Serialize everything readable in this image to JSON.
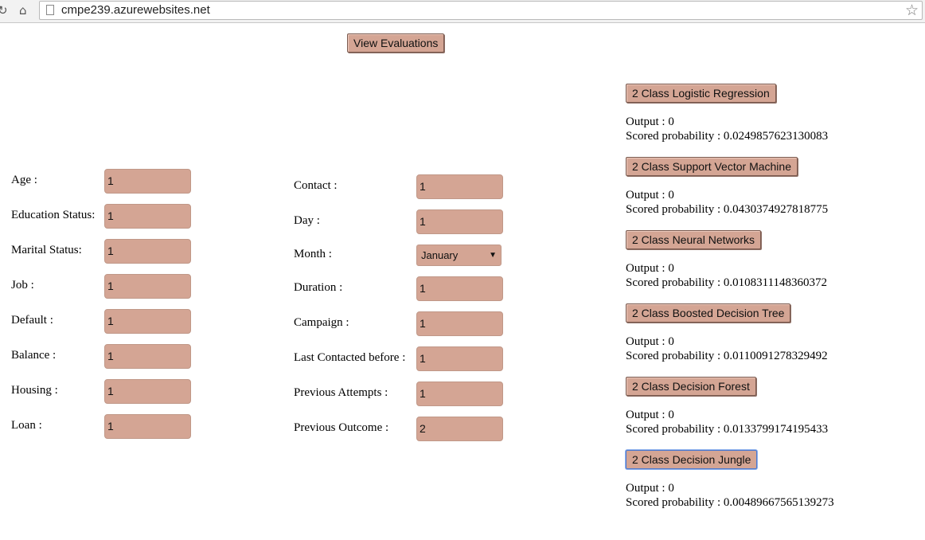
{
  "browser": {
    "url": "cmpe239.azurewebsites.net",
    "reload_icon": "reload-icon",
    "home_icon": "home-icon",
    "star_icon": "bookmark-star-icon"
  },
  "view_evaluations_label": "View Evaluations",
  "form_left": [
    {
      "label": "Age :",
      "value": "1"
    },
    {
      "label": "Education Status:",
      "value": "1"
    },
    {
      "label": "Marital Status:",
      "value": "1"
    },
    {
      "label": "Job :",
      "value": "1"
    },
    {
      "label": "Default :",
      "value": "1"
    },
    {
      "label": "Balance :",
      "value": "1"
    },
    {
      "label": "Housing :",
      "value": "1"
    },
    {
      "label": "Loan :",
      "value": "1"
    }
  ],
  "form_right": [
    {
      "label": "Contact :",
      "value": "1"
    },
    {
      "label": "Day :",
      "value": "1"
    },
    {
      "label": "Month :",
      "value": "January",
      "type": "select"
    },
    {
      "label": "Duration :",
      "value": "1"
    },
    {
      "label": "Campaign :",
      "value": "1"
    },
    {
      "label": "Last Contacted before :",
      "value": "1"
    },
    {
      "label": "Previous Attempts :",
      "value": "1"
    },
    {
      "label": "Previous Outcome :",
      "value": "2"
    }
  ],
  "models": [
    {
      "button": "2 Class Logistic Regression",
      "output": "Output : 0",
      "probability": "Scored probability : 0.0249857623130083"
    },
    {
      "button": "2 Class Support Vector Machine",
      "output": "Output : 0",
      "probability": "Scored probability : 0.0430374927818775"
    },
    {
      "button": "2 Class Neural Networks",
      "output": "Output : 0",
      "probability": "Scored probability : 0.0108311148360372"
    },
    {
      "button": "2 Class Boosted Decision Tree",
      "output": "Output : 0",
      "probability": "Scored probability : 0.0110091278329492"
    },
    {
      "button": "2 Class Decision Forest",
      "output": "Output : 0",
      "probability": "Scored probability : 0.0133799174195433"
    },
    {
      "button": "2 Class Decision Jungle",
      "output": "Output : 0",
      "probability": "Scored probability : 0.00489667565139273"
    }
  ],
  "colors": {
    "button_fill": "#d4a594",
    "field_fill": "#d4a594"
  }
}
